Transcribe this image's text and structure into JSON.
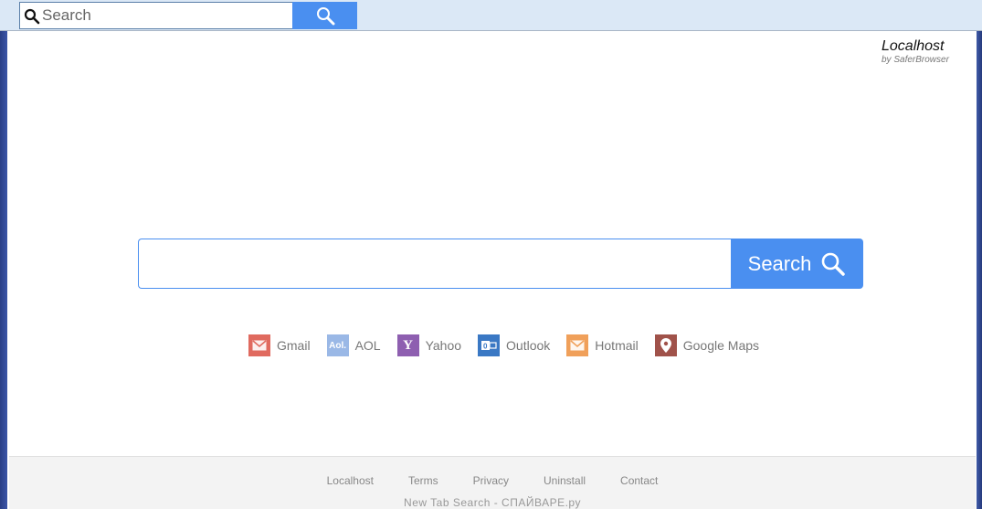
{
  "topbar": {
    "search_placeholder": "Search",
    "search_icon": "search-icon",
    "button_icon": "search-icon"
  },
  "brand": {
    "name": "Localhost",
    "sub": "by SaferBrowser"
  },
  "main_search": {
    "value": "",
    "button_label": "Search",
    "accent_color": "#4a8ff0"
  },
  "quick_links": [
    {
      "label": "Gmail",
      "icon": "gmail-icon",
      "color": "#e06a5f"
    },
    {
      "label": "AOL",
      "icon": "aol-icon",
      "color": "#9ab8e6"
    },
    {
      "label": "Yahoo",
      "icon": "yahoo-icon",
      "color": "#8e5fb0"
    },
    {
      "label": "Outlook",
      "icon": "outlook-icon",
      "color": "#3a78c4"
    },
    {
      "label": "Hotmail",
      "icon": "hotmail-icon",
      "color": "#f0a05a"
    },
    {
      "label": "Google Maps",
      "icon": "map-pin-icon",
      "color": "#a0524a"
    }
  ],
  "footer": {
    "links": [
      "Localhost",
      "Terms",
      "Privacy",
      "Uninstall",
      "Contact"
    ],
    "note": "New  Tab  Search - СПАЙВАРЕ.ру"
  }
}
